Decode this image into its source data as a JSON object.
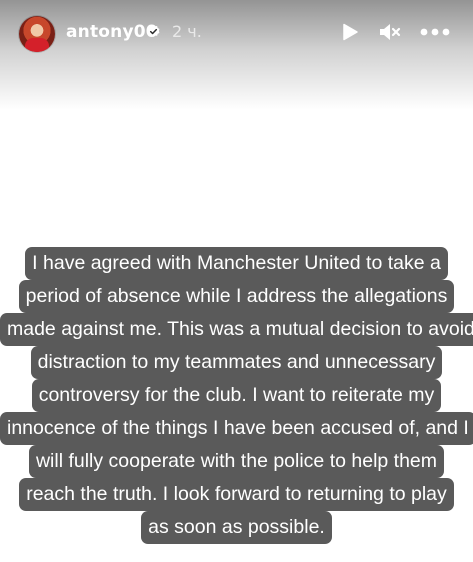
{
  "story": {
    "username": "antony00",
    "time_ago": "2 ч.",
    "verified": true,
    "icons": {
      "avatar": "profile-avatar",
      "verified": "verified-badge-icon",
      "play": "play-icon",
      "mute": "speaker-muted-icon",
      "more": "more-options-icon"
    }
  },
  "caption": {
    "lines": [
      "I have agreed with Manchester United to take a",
      "period of absence while I address the allegations",
      "made against me. This was a mutual decision to avoid",
      "distraction to my teammates and unnecessary",
      "controversy for the club. I want to reiterate my",
      "innocence of the things I have been accused of, and I",
      "will fully cooperate with the police to help them",
      "reach the truth. I look forward to returning to play",
      "as soon as possible."
    ]
  }
}
